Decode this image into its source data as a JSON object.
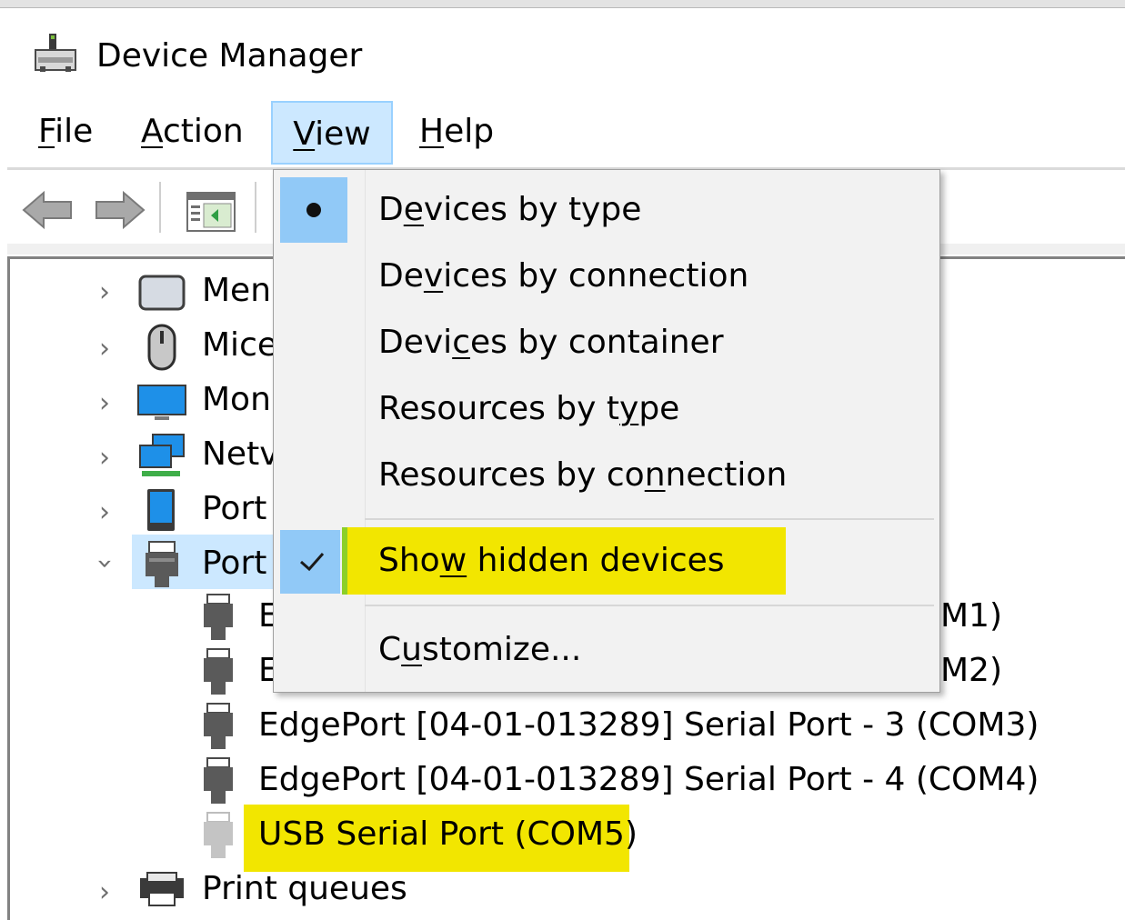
{
  "window": {
    "title": "Device Manager"
  },
  "menubar": {
    "file": {
      "label_u": "F",
      "label_rest": "ile"
    },
    "action": {
      "label_u": "A",
      "label_rest": "ction"
    },
    "view": {
      "label_u": "V",
      "label_rest": "iew"
    },
    "help": {
      "label_u": "H",
      "label_rest": "elp"
    }
  },
  "toolbar": {
    "icons": [
      "back-arrow-icon",
      "forward-arrow-icon",
      "properties-window-icon"
    ]
  },
  "tree": {
    "categories": [
      {
        "label": "Men",
        "icon": "memory-device-icon",
        "expanded": false
      },
      {
        "label": "Mice",
        "icon": "mouse-icon",
        "expanded": false
      },
      {
        "label": "Mon",
        "icon": "monitor-icon",
        "expanded": false
      },
      {
        "label": "Netv",
        "icon": "network-adapter-icon",
        "expanded": false
      },
      {
        "label": "Port",
        "icon": "portable-device-icon",
        "expanded": false
      },
      {
        "label": "Port",
        "icon": "port-connector-icon",
        "expanded": true
      }
    ],
    "ports_children": [
      {
        "label_left": "E",
        "label_right": "M1)"
      },
      {
        "label_left": "E",
        "label_right": "M2)"
      },
      {
        "label": "EdgePort [04-01-013289] Serial Port - 3 (COM3)"
      },
      {
        "label": "EdgePort [04-01-013289] Serial Port - 4 (COM4)"
      },
      {
        "label": "USB Serial Port (COM5)",
        "hidden_device": true,
        "highlighted": true
      }
    ],
    "print_queues": {
      "label": "Print queues"
    }
  },
  "view_menu": {
    "devices_by_type": {
      "before": "D",
      "u": "e",
      "after": "vices by type",
      "selected_radio": true
    },
    "devices_by_connection": {
      "before": "De",
      "u": "v",
      "after": "ices by connection"
    },
    "devices_by_container": {
      "before": "Devi",
      "u": "c",
      "after": "es by container"
    },
    "resources_by_type": {
      "before": "Resources by t",
      "u": "y",
      "after": "pe"
    },
    "resources_by_connection": {
      "before": "Resources by co",
      "u": "n",
      "after": "nection"
    },
    "show_hidden_devices": {
      "before": "Sho",
      "u": "w",
      "after": " hidden devices",
      "checked": true,
      "highlighted": true
    },
    "customize": {
      "before": "C",
      "u": "u",
      "after": "stomize..."
    }
  },
  "colors": {
    "menu_selected_bg": "#cce8ff",
    "menu_selected_border": "#99d1ff",
    "check_gutter": "#91c9f7",
    "highlight_yellow": "#f2e600",
    "highlight_green_edge": "#8ccf28"
  }
}
